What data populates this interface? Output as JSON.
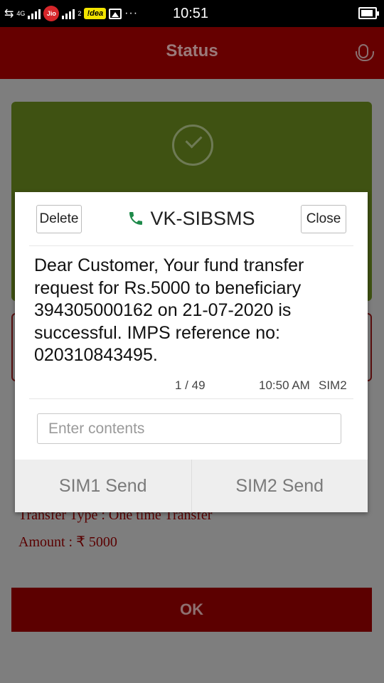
{
  "status_bar": {
    "sim1_network": "4G",
    "carrier1": "Jio",
    "sim2_index": "2",
    "carrier2": "!dea",
    "more": "···",
    "time": "10:51"
  },
  "app_bar": {
    "title": "Status"
  },
  "background_page": {
    "transfer_type": "Transfer Type : One time Transfer",
    "amount": "Amount : ₹ 5000",
    "ok_label": "OK"
  },
  "dialog": {
    "delete_label": "Delete",
    "close_label": "Close",
    "sender": "VK-SIBSMS",
    "message": "Dear Customer, Your fund transfer request for Rs.5000 to beneficiary 394305000162 on 21-07-2020 is successful. IMPS reference no: 020310843495.",
    "counter": "1 / 49",
    "timestamp": "10:50 AM",
    "sim": "SIM2",
    "input_placeholder": "Enter contents",
    "sim1_send": "SIM1 Send",
    "sim2_send": "SIM2 Send"
  },
  "colors": {
    "app_bar": "#660000",
    "success_card": "#3f5212",
    "call_icon": "#1e8a4a"
  }
}
